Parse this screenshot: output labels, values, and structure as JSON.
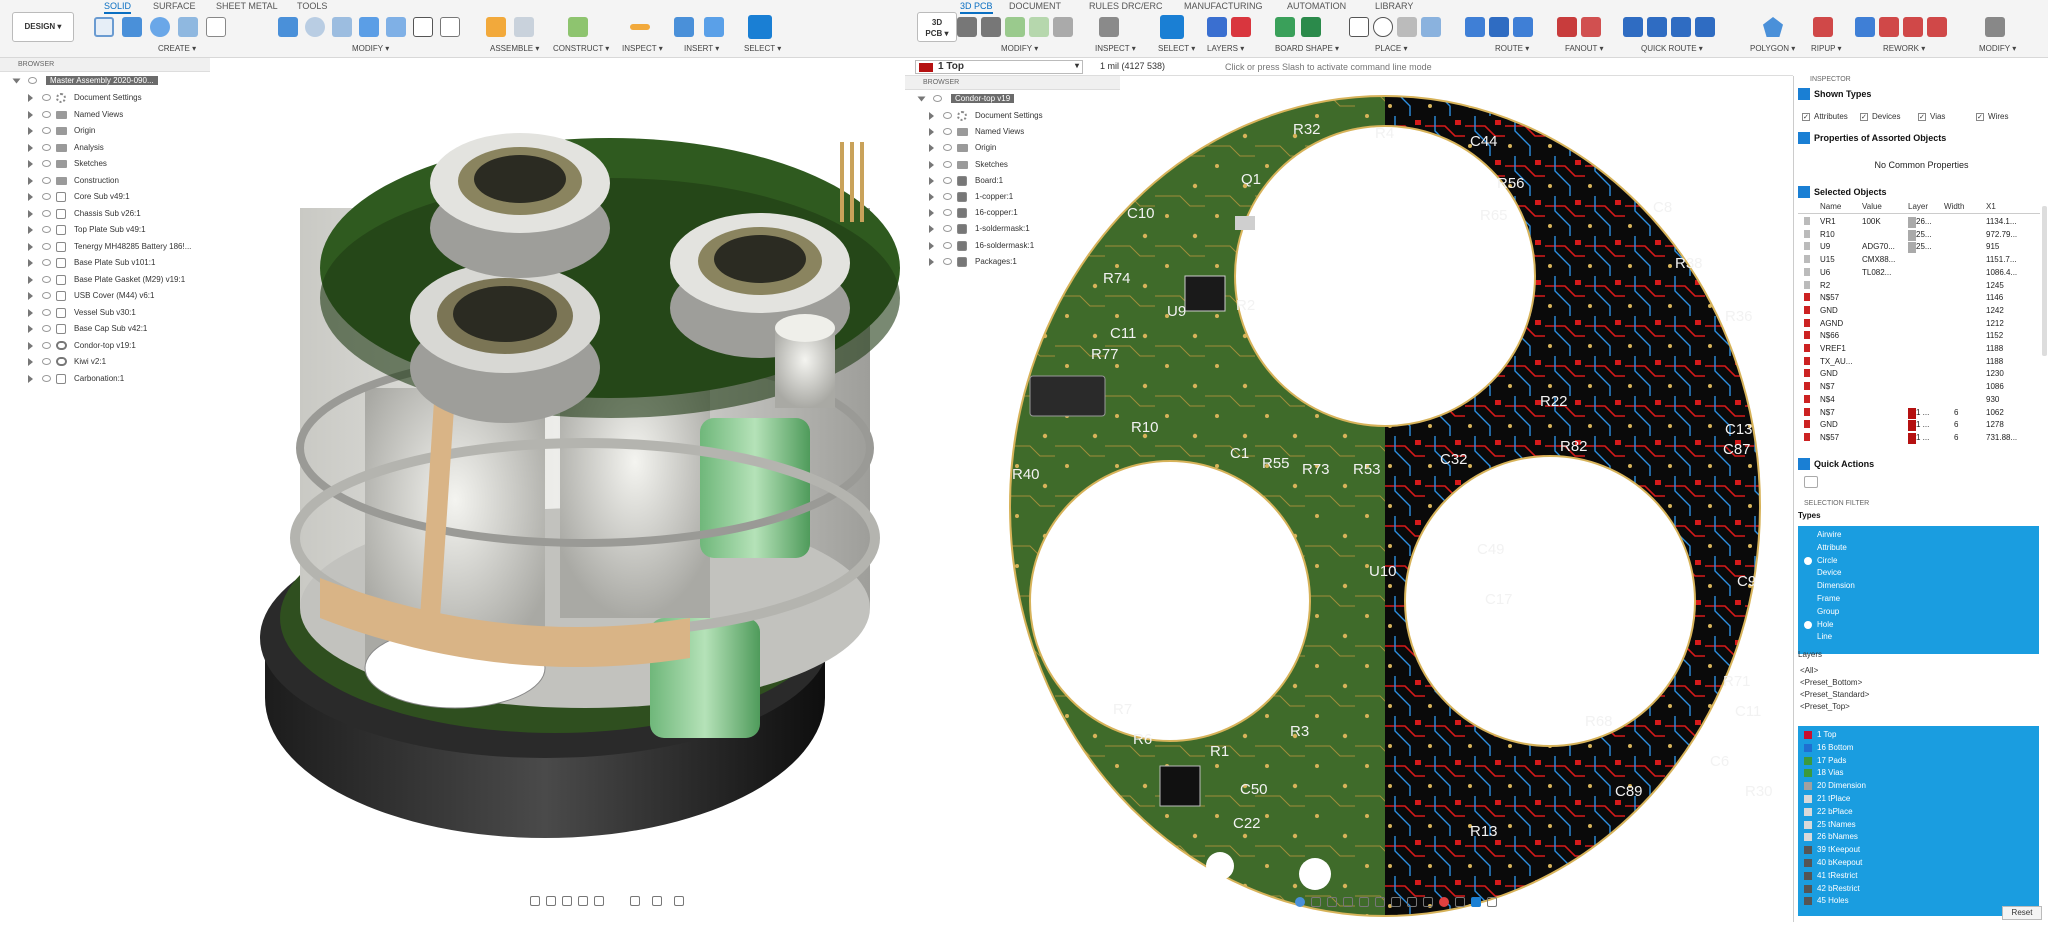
{
  "left_toolbar": {
    "design_button": "DESIGN ▾",
    "tabs": [
      "SOLID",
      "SURFACE",
      "SHEET METAL",
      "TOOLS"
    ],
    "active_tab": "SOLID",
    "groups": [
      "CREATE ▾",
      "MODIFY ▾",
      "ASSEMBLE ▾",
      "CONSTRUCT ▾",
      "INSPECT ▾",
      "INSERT ▾",
      "SELECT ▾"
    ]
  },
  "right_toolbar": {
    "pcb_button_line1": "3D",
    "pcb_button_line2": "PCB ▾",
    "tabs": [
      "3D PCB",
      "DOCUMENT",
      "RULES DRC/ERC",
      "MANUFACTURING",
      "AUTOMATION",
      "LIBRARY"
    ],
    "active_tab": "3D PCB",
    "groups": [
      "MODIFY ▾",
      "INSPECT ▾",
      "SELECT ▾",
      "LAYERS ▾",
      "BOARD SHAPE ▾",
      "PLACE ▾",
      "ROUTE ▾",
      "FANOUT ▾",
      "QUICK ROUTE ▾",
      "POLYGON ▾",
      "RIPUP ▾",
      "REWORK ▾",
      "MODIFY ▾"
    ]
  },
  "left_browser": {
    "header": "BROWSER",
    "root": "Master Assembly 2020-090...",
    "items": [
      {
        "label": "Document Settings",
        "icon": "gear"
      },
      {
        "label": "Named Views",
        "icon": "folder"
      },
      {
        "label": "Origin",
        "icon": "folder"
      },
      {
        "label": "Analysis",
        "icon": "folder"
      },
      {
        "label": "Sketches",
        "icon": "folder"
      },
      {
        "label": "Construction",
        "icon": "folder"
      },
      {
        "label": "Core Sub v49:1",
        "icon": "component"
      },
      {
        "label": "Chassis Sub v26:1",
        "icon": "component"
      },
      {
        "label": "Top Plate Sub v49:1",
        "icon": "component"
      },
      {
        "label": "Tenergy MH48285 Battery 186!...",
        "icon": "component"
      },
      {
        "label": "Base Plate Sub v101:1",
        "icon": "component"
      },
      {
        "label": "Base Plate Gasket (M29) v19:1",
        "icon": "component"
      },
      {
        "label": "USB Cover (M44) v6:1",
        "icon": "component"
      },
      {
        "label": "Vessel Sub v30:1",
        "icon": "component"
      },
      {
        "label": "Base Cap Sub v42:1",
        "icon": "component"
      },
      {
        "label": "Condor-top v19:1",
        "icon": "link"
      },
      {
        "label": "Kiwi v2:1",
        "icon": "link"
      },
      {
        "label": "Carbonation:1",
        "icon": "component"
      }
    ]
  },
  "pcb_topbar": {
    "layer": "1 Top",
    "unit_readout": "1 mil (4127 538)",
    "command_placeholder": "Click or press Slash to activate command line mode"
  },
  "pcb_browser": {
    "header": "BROWSER",
    "root": "Condor-top v19",
    "items": [
      {
        "label": "Document Settings",
        "icon": "gear"
      },
      {
        "label": "Named Views",
        "icon": "folder"
      },
      {
        "label": "Origin",
        "icon": "folder"
      },
      {
        "label": "Sketches",
        "icon": "folder"
      },
      {
        "label": "Board:1",
        "icon": "layer"
      },
      {
        "label": "1-copper:1",
        "icon": "layer"
      },
      {
        "label": "16-copper:1",
        "icon": "layer"
      },
      {
        "label": "1-soldermask:1",
        "icon": "layer"
      },
      {
        "label": "16-soldermask:1",
        "icon": "layer"
      },
      {
        "label": "Packages:1",
        "icon": "layer"
      }
    ]
  },
  "silkscreen_labels": [
    "R32",
    "R4",
    "Q1",
    "C10",
    "R74",
    "U9",
    "R2",
    "C11",
    "R77",
    "R10",
    "C1",
    "R55",
    "R73",
    "R53",
    "R40",
    "R7",
    "R6",
    "R1",
    "R3",
    "C50",
    "C22",
    "U10",
    "R36",
    "C13",
    "C87",
    "C89",
    "R38",
    "C8",
    "C44",
    "R56",
    "R65",
    "C32",
    "C49",
    "C17",
    "R22",
    "C9",
    "R82",
    "C11",
    "R68",
    "R71",
    "C6",
    "R30",
    "R13"
  ],
  "inspector": {
    "header": "INSPECTOR",
    "shown_types_title": "Shown Types",
    "shown_types": [
      "Attributes",
      "Devices",
      "Vias",
      "Wires"
    ],
    "properties_title": "Properties of Assorted Objects",
    "no_common": "No Common Properties",
    "selected_title": "Selected Objects",
    "columns": [
      "Name",
      "Value",
      "Layer",
      "Width",
      "X1"
    ],
    "rows": [
      {
        "name": "VR1",
        "value": "100K",
        "layer": "26...",
        "width": "",
        "x1": "1134.1..."
      },
      {
        "name": "R10",
        "value": "",
        "layer": "25...",
        "width": "",
        "x1": "972.79..."
      },
      {
        "name": "U9",
        "value": "ADG70...",
        "layer": "25...",
        "width": "",
        "x1": "915"
      },
      {
        "name": "U15",
        "value": "CMX88...",
        "layer": "",
        "width": "",
        "x1": "1151.7..."
      },
      {
        "name": "U6",
        "value": "TL082...",
        "layer": "",
        "width": "",
        "x1": "1086.4..."
      },
      {
        "name": "R2",
        "value": "",
        "layer": "",
        "width": "",
        "x1": "1245"
      },
      {
        "name": "N$57",
        "value": "",
        "layer": "",
        "width": "",
        "x1": "1146"
      },
      {
        "name": "GND",
        "value": "",
        "layer": "",
        "width": "",
        "x1": "1242"
      },
      {
        "name": "AGND",
        "value": "",
        "layer": "",
        "width": "",
        "x1": "1212"
      },
      {
        "name": "N$66",
        "value": "",
        "layer": "",
        "width": "",
        "x1": "1152"
      },
      {
        "name": "VREF1",
        "value": "",
        "layer": "",
        "width": "",
        "x1": "1188"
      },
      {
        "name": "TX_AU...",
        "value": "",
        "layer": "",
        "width": "",
        "x1": "1188"
      },
      {
        "name": "GND",
        "value": "",
        "layer": "",
        "width": "",
        "x1": "1230"
      },
      {
        "name": "N$7",
        "value": "",
        "layer": "",
        "width": "",
        "x1": "1086"
      },
      {
        "name": "N$4",
        "value": "",
        "layer": "",
        "width": "",
        "x1": "930"
      },
      {
        "name": "N$7",
        "value": "",
        "layer": "1 ...",
        "width": "6",
        "x1": "1062"
      },
      {
        "name": "GND",
        "value": "",
        "layer": "1 ...",
        "width": "6",
        "x1": "1278"
      },
      {
        "name": "N$57",
        "value": "",
        "layer": "1 ...",
        "width": "6",
        "x1": "731.88..."
      }
    ],
    "quick_actions_title": "Quick Actions",
    "selection_filter_header": "SELECTION FILTER",
    "types_title": "Types",
    "types": [
      "Airwire",
      "Attribute",
      "Circle",
      "Device",
      "Dimension",
      "Frame",
      "Group",
      "Hole",
      "Line"
    ],
    "layers_title": "Layers",
    "presets": [
      "<All>",
      "<Preset_Bottom>",
      "<Preset_Standard>",
      "<Preset_Top>"
    ],
    "layers": [
      {
        "name": "1 Top",
        "color": "#c8102e"
      },
      {
        "name": "16 Bottom",
        "color": "#1f6fd0"
      },
      {
        "name": "17 Pads",
        "color": "#3c9a3c"
      },
      {
        "name": "18 Vias",
        "color": "#3c9a3c"
      },
      {
        "name": "20 Dimension",
        "color": "#a0a0a0"
      },
      {
        "name": "21 tPlace",
        "color": "#d9d9d9"
      },
      {
        "name": "22 bPlace",
        "color": "#d9d9d9"
      },
      {
        "name": "25 tNames",
        "color": "#d9d9d9"
      },
      {
        "name": "26 bNames",
        "color": "#d9d9d9"
      },
      {
        "name": "39 tKeepout",
        "color": "#555555"
      },
      {
        "name": "40 bKeepout",
        "color": "#555555"
      },
      {
        "name": "41 tRestrict",
        "color": "#555555"
      },
      {
        "name": "42 bRestrict",
        "color": "#555555"
      },
      {
        "name": "45 Holes",
        "color": "#555555"
      }
    ],
    "reset_button": "Reset"
  },
  "colors": {
    "accent": "#1a9de0",
    "pcb_green": "#3f6b2a",
    "pcb_black": "#0a0a0a",
    "top_copper": "#d61a1a",
    "bottom_copper": "#2d8fe0",
    "pad_gold": "#d7b35a"
  }
}
